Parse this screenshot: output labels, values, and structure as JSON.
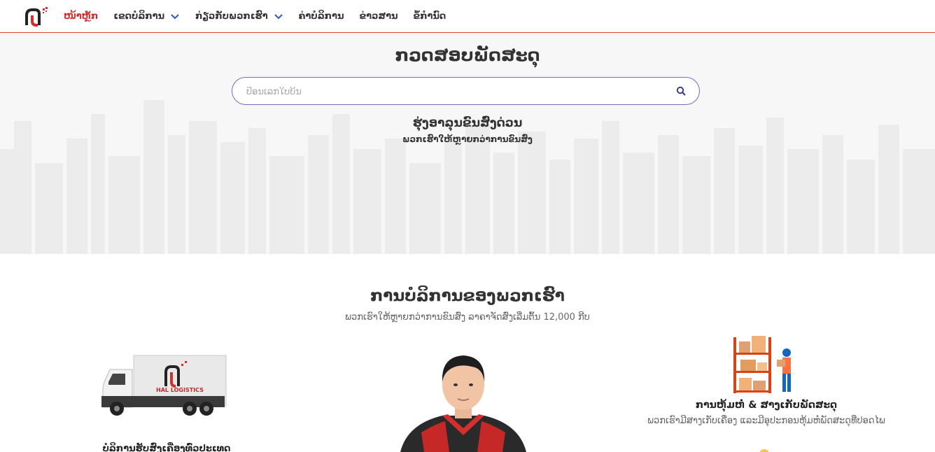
{
  "nav": {
    "logo_icon": "hal-logo-icon",
    "items": [
      {
        "label": "ໜ້າຫຼັກ",
        "active": true,
        "dropdown": false
      },
      {
        "label": "ເຂດບໍລິການ",
        "active": false,
        "dropdown": true
      },
      {
        "label": "ກ່ຽວກັບພວກເຮົາ",
        "active": false,
        "dropdown": true
      },
      {
        "label": "ຄ່າບໍລິການ",
        "active": false,
        "dropdown": false
      },
      {
        "label": "ຂ່າວສານ",
        "active": false,
        "dropdown": false
      },
      {
        "label": "ຂໍ້ກຳນົດ",
        "active": false,
        "dropdown": false
      }
    ],
    "accent_color": "#d32f2f"
  },
  "hero": {
    "title": "ກວດສອບພັດສະດຸ",
    "search_placeholder": "ປ້ອນເລກໃບບິນ",
    "search_value": "",
    "search_icon": "search-icon",
    "subtitle": "ຮຸ່ງອາລຸນຂົນສົ່ງດ່ວນ",
    "tagline": "ພວກເຮົາໃຫ້ຫຼາຍກວ່າການຂົນສົ່ງ",
    "border_color": "#7e66c8"
  },
  "services": {
    "title": "ການບໍລິການຂອງພວກເຮົາ",
    "subtitle": "ພວກເຮົາໃຫ້ຫຼາຍກວ່າການຂົນສົ່ງ ລາຄາຈັດສົ່ງເລີ່ມຕົ້ນ 12,000 ກີບ",
    "cards": [
      {
        "icon": "delivery-truck-icon",
        "truck_text": "HAL LOGISTICS",
        "title": "ບໍລິການຮັບສົ່ງເຄື່ອງທົ່ວປະເທດ"
      },
      {
        "icon": "courier-person-image"
      },
      {
        "icon": "warehouse-worker-icon",
        "title": "ການຫຸ້ມຫໍ່ & ສາງເກັບພັດສະດຸ",
        "description": "ພວກເຮົາມີສາງເກັບເຄື່ອງ ແລະມີອຸປະກອນຫຸ້ມຫໍ່ພັດສະດຸທີ່ປອດໄພ"
      }
    ]
  }
}
